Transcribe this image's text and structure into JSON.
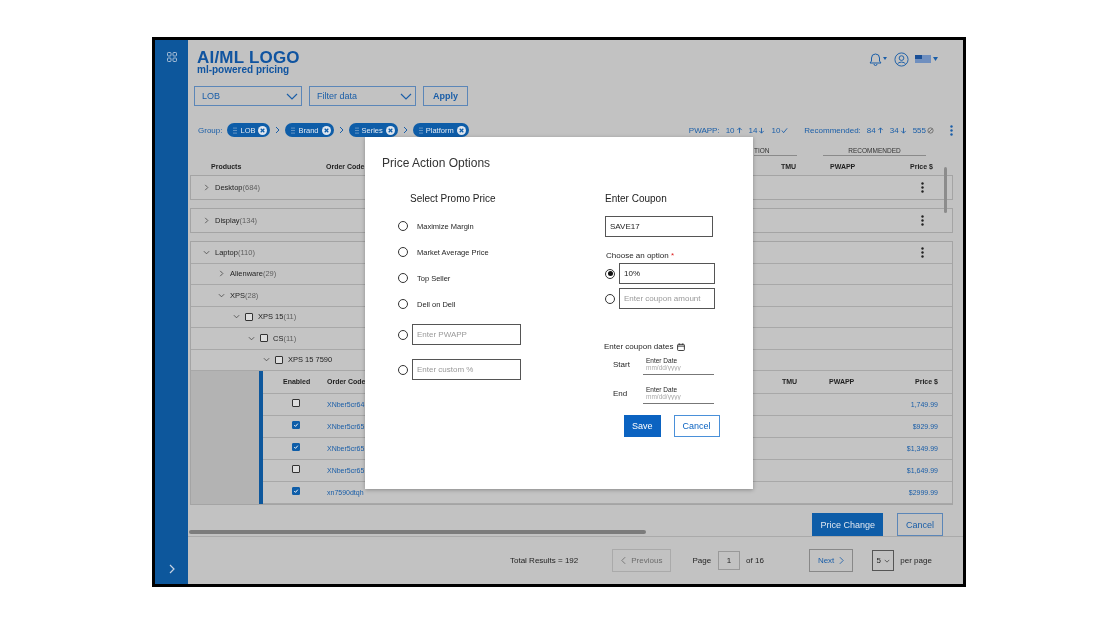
{
  "header": {
    "logo_title": "AI/ML LOGO",
    "logo_subtitle": "ml-powered pricing"
  },
  "filters": {
    "dropdowns": [
      {
        "value": "LOB"
      },
      {
        "value": "Filter data"
      }
    ],
    "apply": "Apply"
  },
  "group": {
    "label": "Group:",
    "chips": [
      "LOB",
      "Brand",
      "Series",
      "Platform"
    ]
  },
  "stats": [
    {
      "label": "PWAPP:",
      "items": [
        {
          "value": "10",
          "kind": "up"
        },
        {
          "value": "14",
          "kind": "down"
        },
        {
          "value": "10",
          "kind": "check"
        }
      ]
    },
    {
      "label": "Recommended:",
      "items": [
        {
          "value": "84",
          "kind": "up"
        },
        {
          "value": "34",
          "kind": "down"
        },
        {
          "value": "555",
          "kind": "blocked"
        }
      ]
    }
  ],
  "table": {
    "group_headers": [
      "TION",
      "RECOMMENDED"
    ],
    "columns": [
      "Products",
      "Order Code",
      "TMU",
      "PWAPP",
      "Price $"
    ],
    "groups": [
      {
        "name": "Desktop",
        "count": "(684)",
        "expanded": false
      },
      {
        "name": "Display",
        "count": "(134)",
        "expanded": false
      },
      {
        "name": "Laptop",
        "count": "(110)",
        "expanded": true,
        "children": [
          {
            "name": "Alienware",
            "count": "(29)",
            "expanded": false
          },
          {
            "name": "XPS",
            "count": "(28)",
            "expanded": true,
            "children": [
              {
                "name": "XPS 15",
                "count": "(11)",
                "expanded": true,
                "checked": false,
                "children": [
                  {
                    "name": "CS",
                    "count": "(11)",
                    "expanded": true,
                    "checked": false,
                    "children": [
                      {
                        "name": "XPS 15 7590",
                        "expanded": true,
                        "checked": false,
                        "detail": {
                          "columns": [
                            "Enabled",
                            "Order Code",
                            "TMU",
                            "PWAPP",
                            "Price $"
                          ],
                          "rows": [
                            {
                              "enabled": false,
                              "order_code": "XNber5cr64",
                              "price": "1,749.99"
                            },
                            {
                              "enabled": true,
                              "order_code": "XNber5cr65",
                              "price": "$929.99"
                            },
                            {
                              "enabled": true,
                              "order_code": "XNber5cr65",
                              "price": "$1,349.99"
                            },
                            {
                              "enabled": false,
                              "order_code": "XNber5cr65",
                              "price": "$1,649.99"
                            },
                            {
                              "enabled": true,
                              "order_code": "xn7590dtqh",
                              "price": "$2999.99"
                            }
                          ]
                        }
                      }
                    ]
                  }
                ]
              }
            ]
          }
        ]
      }
    ]
  },
  "actions": [
    "Price Change",
    "Cancel"
  ],
  "pagination": {
    "total": "Total Results = 192",
    "previous": "Previous",
    "previous_disabled": true,
    "page_label": "Page",
    "page": "1",
    "of": "of 16",
    "next": "Next",
    "per_page": "5",
    "per_page_label": "per page"
  },
  "modal": {
    "title": "Price Action Options",
    "promo": {
      "heading": "Select Promo Price",
      "options": [
        {
          "kind": "radio",
          "label": "Maximize Margin",
          "selected": false
        },
        {
          "kind": "radio",
          "label": "Market Average Price",
          "selected": false
        },
        {
          "kind": "radio",
          "label": "Top Seller",
          "selected": false
        },
        {
          "kind": "radio",
          "label": "Dell on Dell",
          "selected": false
        },
        {
          "kind": "input",
          "placeholder": "Enter PWAPP",
          "selected": false
        },
        {
          "kind": "input",
          "placeholder": "Enter custom %",
          "selected": false
        }
      ]
    },
    "coupon": {
      "heading": "Enter Coupon",
      "code": "SAVE17",
      "choose_label": "Choose an option",
      "required": "*",
      "options": [
        {
          "value": "10%",
          "selected": true
        },
        {
          "placeholder": "Enter coupon amount",
          "selected": false
        }
      ],
      "dates_label": "Enter coupon dates",
      "dates": [
        {
          "label": "Start",
          "field_label": "Enter Date",
          "placeholder": "mm/dd/yyyy"
        },
        {
          "label": "End",
          "field_label": "Enter Date",
          "placeholder": "mm/dd/yyyy"
        }
      ]
    },
    "buttons": [
      "Save",
      "Cancel"
    ]
  }
}
